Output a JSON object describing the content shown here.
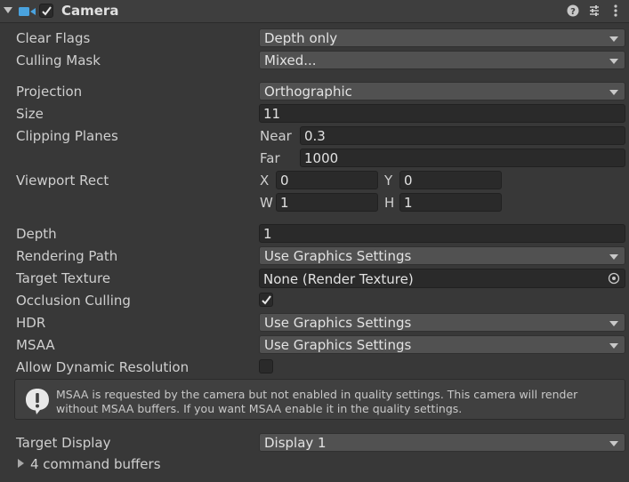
{
  "header": {
    "title": "Camera",
    "enabled": true,
    "icons": [
      "camera-icon",
      "help-icon",
      "preset-icon",
      "kebab-menu-icon"
    ]
  },
  "fields": {
    "clear_flags": {
      "label": "Clear Flags",
      "value": "Depth only"
    },
    "culling_mask": {
      "label": "Culling Mask",
      "value": "Mixed..."
    },
    "projection": {
      "label": "Projection",
      "value": "Orthographic"
    },
    "size": {
      "label": "Size",
      "value": "11"
    },
    "clipping_planes": {
      "label": "Clipping Planes",
      "near_label": "Near",
      "near": "0.3",
      "far_label": "Far",
      "far": "1000"
    },
    "viewport_rect": {
      "label": "Viewport Rect",
      "x_label": "X",
      "x": "0",
      "y_label": "Y",
      "y": "0",
      "w_label": "W",
      "w": "1",
      "h_label": "H",
      "h": "1"
    },
    "depth": {
      "label": "Depth",
      "value": "1"
    },
    "rendering_path": {
      "label": "Rendering Path",
      "value": "Use Graphics Settings"
    },
    "target_texture": {
      "label": "Target Texture",
      "value": "None (Render Texture)"
    },
    "occlusion_culling": {
      "label": "Occlusion Culling",
      "checked": true
    },
    "hdr": {
      "label": "HDR",
      "value": "Use Graphics Settings"
    },
    "msaa": {
      "label": "MSAA",
      "value": "Use Graphics Settings"
    },
    "allow_dynamic_resolution": {
      "label": "Allow Dynamic Resolution",
      "checked": false
    },
    "target_display": {
      "label": "Target Display",
      "value": "Display 1"
    }
  },
  "help_box": {
    "text": "MSAA is requested by the camera but not enabled in quality settings. This camera will render without MSAA buffers. If you want MSAA enable it in the quality settings."
  },
  "command_buffers": {
    "label": "4 command buffers"
  },
  "colors": {
    "accent": "#4aa3df",
    "background": "#383838",
    "field": "#2a2a2a",
    "dropdown": "#515151"
  }
}
